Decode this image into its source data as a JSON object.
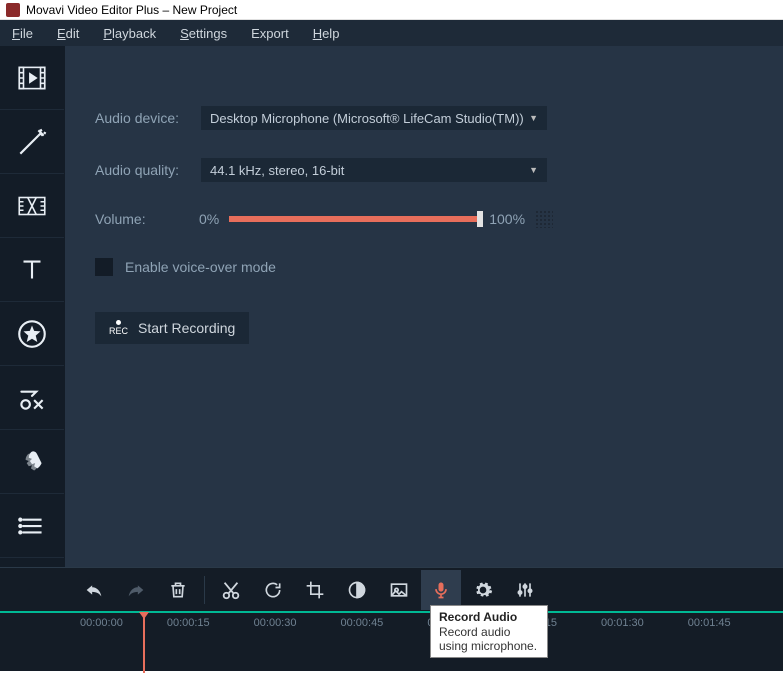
{
  "title": "Movavi Video Editor Plus – New Project",
  "menu": [
    "File",
    "Edit",
    "Playback",
    "Settings",
    "Export",
    "Help"
  ],
  "panel": {
    "audio_device_label": "Audio device:",
    "audio_device_value": "Desktop Microphone (Microsoft® LifeCam Studio(TM))",
    "audio_quality_label": "Audio quality:",
    "audio_quality_value": "44.1 kHz, stereo, 16-bit",
    "volume_label": "Volume:",
    "volume_min": "0%",
    "volume_max": "100%",
    "voiceover_label": "Enable voice-over mode",
    "record_label": "Start Recording"
  },
  "tooltip": {
    "title": "Record Audio",
    "body": "Record audio using microphone."
  },
  "timeline_ticks": [
    "00:00:00",
    "00:00:15",
    "00:00:30",
    "00:00:45",
    "00:01:00",
    "00:01:15",
    "00:01:30",
    "00:01:45"
  ]
}
